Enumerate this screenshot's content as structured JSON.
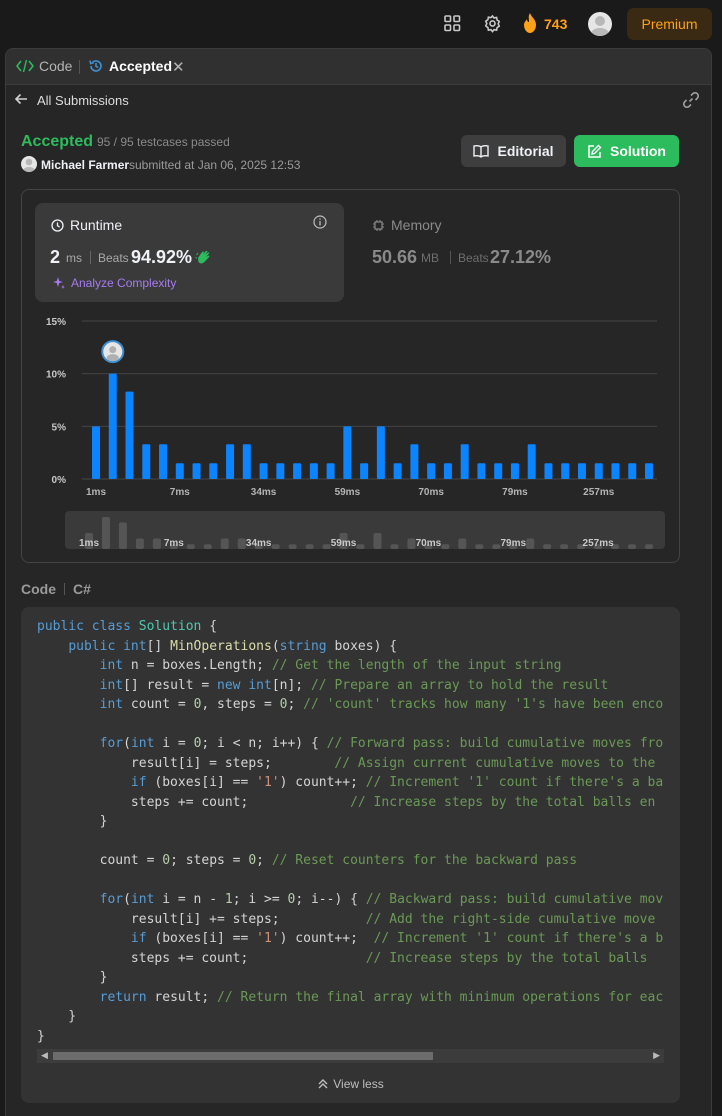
{
  "topbar": {
    "streak": "743",
    "premium": "Premium"
  },
  "tabs": {
    "code": "Code",
    "accepted": "Accepted"
  },
  "back": {
    "label": "All Submissions"
  },
  "result": {
    "status": "Accepted",
    "cases": "95 / 95 testcases passed",
    "user": "Michael Farmer",
    "submitted": "submitted at Jan 06, 2025 12:53"
  },
  "buttons": {
    "editorial": "Editorial",
    "solution": "Solution"
  },
  "runtime": {
    "title": "Runtime",
    "value": "2",
    "unit": "ms",
    "beats": "Beats",
    "percent": "94.92%",
    "analyze": "Analyze Complexity"
  },
  "memory": {
    "title": "Memory",
    "value": "50.66",
    "unit": "MB",
    "beats": "Beats",
    "percent": "27.12%"
  },
  "colors": {
    "accent_green": "#2cbb5d",
    "bar_blue": "#0a84ff",
    "brand_orange": "#ffa116"
  },
  "chart_data": {
    "type": "bar",
    "ytick_labels": [
      "15%",
      "10%",
      "5%",
      "0%"
    ],
    "ylim": [
      0,
      15
    ],
    "xtick_labels": [
      "1ms",
      "7ms",
      "34ms",
      "59ms",
      "70ms",
      "79ms",
      "257ms"
    ],
    "values": [
      5,
      10,
      8.3,
      3.3,
      3.3,
      1.5,
      1.5,
      1.5,
      3.3,
      3.3,
      1.5,
      1.5,
      1.5,
      1.5,
      1.5,
      5,
      1.5,
      5,
      1.5,
      3.3,
      1.5,
      1.5,
      3.3,
      1.5,
      1.5,
      1.5,
      3.3,
      1.5,
      1.5,
      1.5,
      1.5,
      1.5,
      1.5,
      1.5
    ],
    "highlight_index": 1
  },
  "code": {
    "header": "Code",
    "language": "C#",
    "view_less": "View less"
  }
}
